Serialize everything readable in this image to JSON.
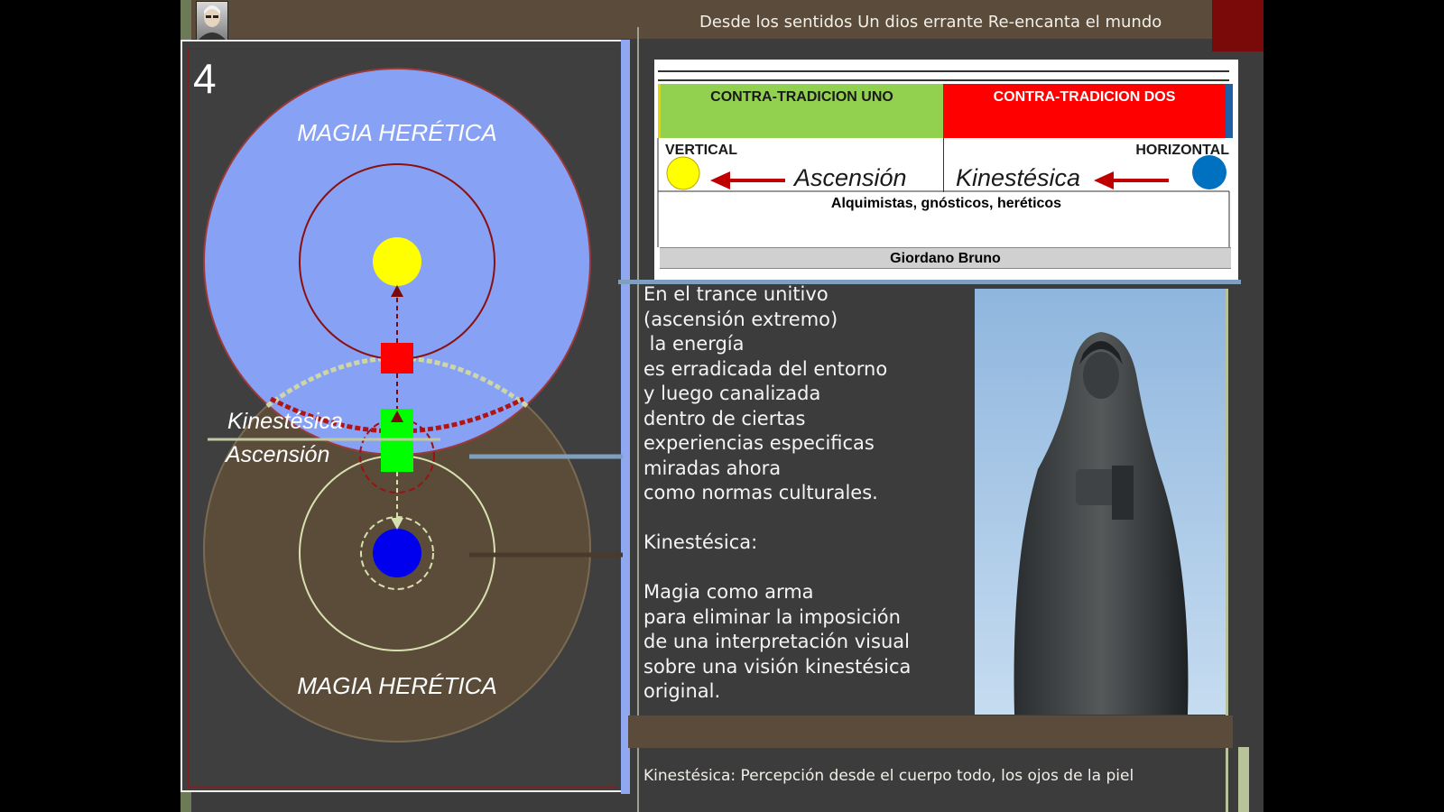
{
  "header": {
    "nav_text": "Desde los sentidos  Un dios errante  Re-encanta el mundo",
    "accent_color": "#7a0a0a",
    "bar_color": "#5a4b3a"
  },
  "diagram": {
    "slide_number": "4",
    "top_title": "MAGIA HERÉTICA",
    "bottom_title": "MAGIA HERÉTICA",
    "label_kinestesica": "Kinestésica",
    "label_ascension": "Ascensión",
    "colors": {
      "upper_circle": "#87a2f5",
      "lower_circle": "#5b4c3a",
      "sun": "#ffff00",
      "earth": "#0000ee",
      "red_node": "#ff0000",
      "green_node": "#00ff00"
    }
  },
  "table": {
    "header_left": "CONTRA-TRADICION  UNO",
    "header_right": "CONTRA-TRADICION  DOS",
    "label_vertical": "VERTICAL",
    "label_horizontal": "HORIZONTAL",
    "word_ascension": "Ascensión",
    "word_kinestesica": "Kinestésica",
    "row_groups": "Alquimistas,  gnósticos, heréticos",
    "row_person": "Giordano Bruno",
    "colors": {
      "left_header": "#92d050",
      "right_header": "#ff0000",
      "yellow_dot": "#ffff00",
      "blue_dot": "#0070c0",
      "arrow": "#c00000"
    }
  },
  "body": {
    "text": "En el trance unitivo\n(ascensión extremo)\n la energía\nes erradicada del entorno\ny luego canalizada\ndentro de ciertas\nexperiencias especificas\nmiradas ahora\ncomo normas culturales.\n\nKinestésica:\n\nMagia como arma\npara eliminar la imposición\nde una interpretación visual\nsobre una visión kinestésica\noriginal."
  },
  "footer": {
    "text": "Kinestésica: Percepción desde el cuerpo todo, los ojos de la piel"
  }
}
